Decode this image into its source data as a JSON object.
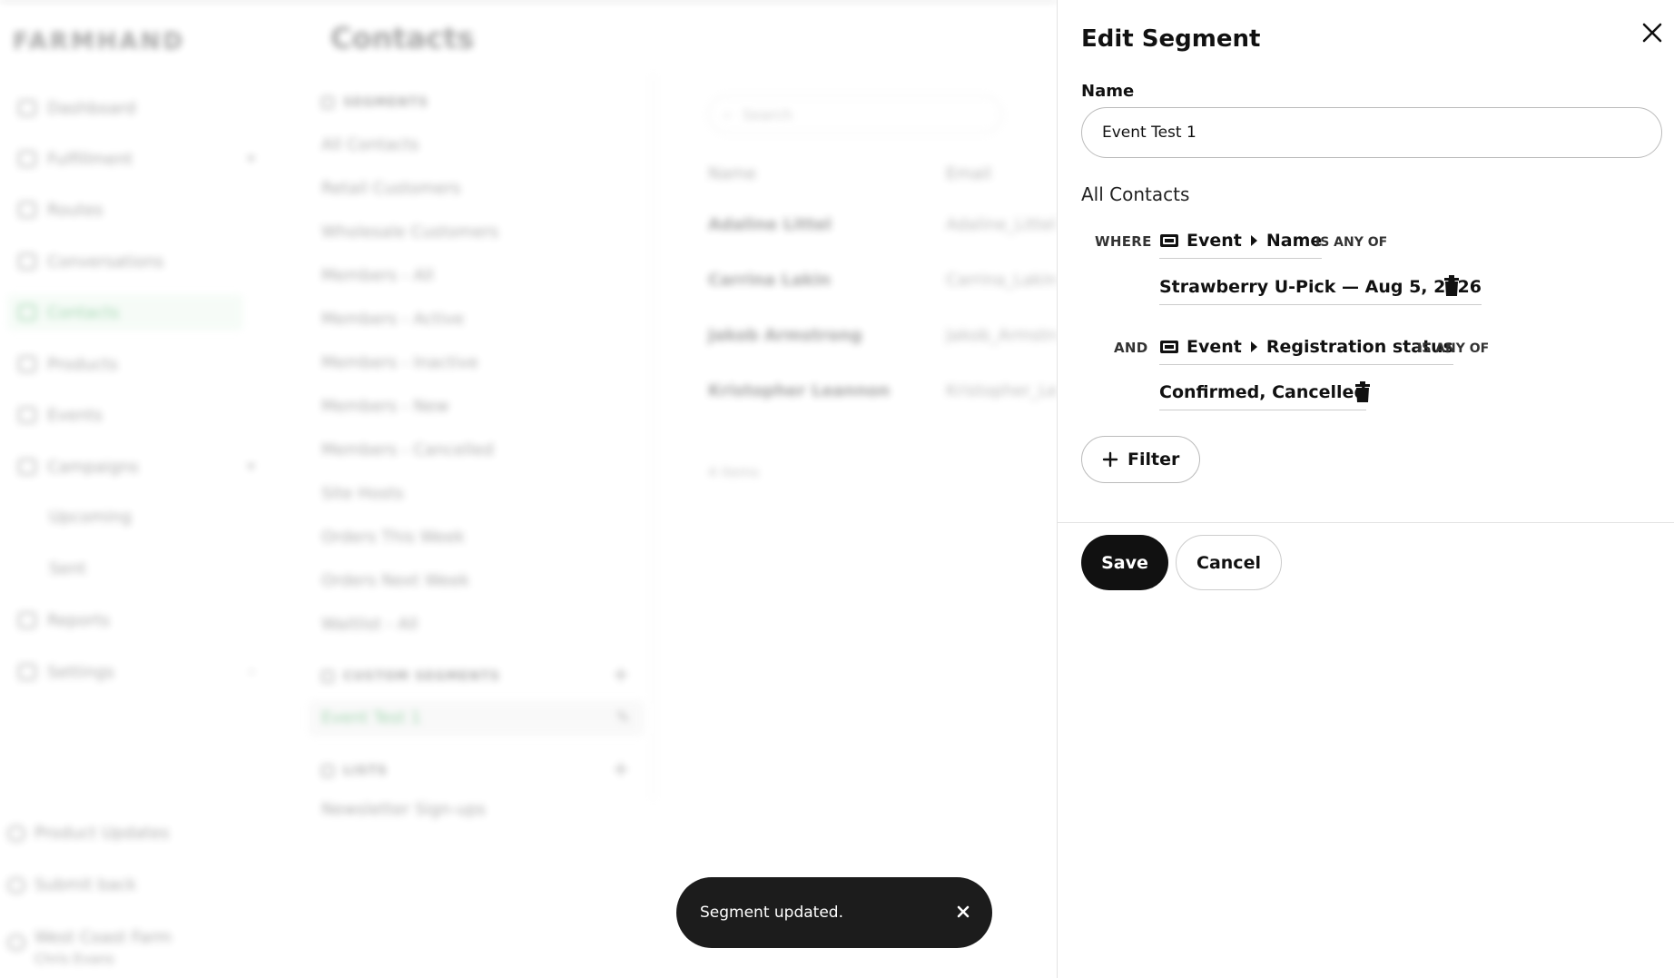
{
  "app": {
    "logo": "FARMHAND",
    "page_title": "Contacts",
    "nav": [
      {
        "label": "Dashboard",
        "icon": "chart-icon"
      },
      {
        "label": "Fulfillment",
        "icon": "calendar-icon",
        "chevron": "▾"
      },
      {
        "label": "Routes",
        "icon": "route-icon"
      },
      {
        "label": "Conversations",
        "icon": "chat-icon"
      },
      {
        "label": "Contacts",
        "icon": "user-icon"
      },
      {
        "label": "Products",
        "icon": "carrot-icon"
      },
      {
        "label": "Events",
        "icon": "calendar-icon"
      },
      {
        "label": "Campaigns",
        "icon": "campaign-icon",
        "chevron": "▾"
      }
    ],
    "nav_sub": [
      "Upcoming",
      "Sent"
    ],
    "nav_more": [
      {
        "label": "Reports",
        "icon": "reports-icon"
      },
      {
        "label": "Settings",
        "icon": "gear-icon",
        "chevron": "›"
      }
    ],
    "nav_bottom": [
      {
        "label": "Product Updates",
        "icon": "megaphone-icon"
      },
      {
        "label": "Submit back",
        "icon": "feedback-icon"
      },
      {
        "label": "West Coast Farm",
        "sub": "Chris Evans",
        "icon": "account-icon"
      }
    ],
    "segments": {
      "heading": "SEGMENTS",
      "items": [
        "All Contacts",
        "Retail Customers",
        "Wholesale Customers",
        "Members - All",
        "Members - Active",
        "Members - Inactive",
        "Members - New",
        "Members - Cancelled",
        "Site Hosts",
        "Orders This Week",
        "Orders Next Week",
        "Waitlist - All"
      ],
      "custom_heading": "CUSTOM SEGMENTS",
      "custom_items": [
        "Event Test 1"
      ],
      "lists_heading": "LISTS",
      "lists_items": [
        "Newsletter Sign-ups"
      ]
    },
    "contacts": {
      "search_placeholder": "Search",
      "columns": [
        "Name",
        "Email"
      ],
      "rows": [
        {
          "name": "Adaline Littel",
          "email": "Adaline_Littel"
        },
        {
          "name": "Carrina Lakin",
          "email": "Carrina_Lakin"
        },
        {
          "name": "Jakob Armstrong",
          "email": "Jakob_Armstrong"
        },
        {
          "name": "Kristopher Leannon",
          "email": "Kristopher_Leannon"
        }
      ],
      "count": "4 items"
    }
  },
  "panel": {
    "title": "Edit Segment",
    "name_label": "Name",
    "name_value": "Event Test 1",
    "base_segment": "All Contacts",
    "conditions": [
      {
        "keyword": "WHERE",
        "entity": "Event",
        "field": "Name",
        "operator": "IS ANY OF",
        "value": "Strawberry U-Pick — Aug 5, 2026"
      },
      {
        "keyword": "AND",
        "entity": "Event",
        "field": "Registration status",
        "operator": "IS ANY OF",
        "value": "Confirmed, Cancelled"
      }
    ],
    "filter_button": "Filter",
    "save_button": "Save",
    "cancel_button": "Cancel"
  },
  "toast": {
    "message": "Segment updated."
  }
}
